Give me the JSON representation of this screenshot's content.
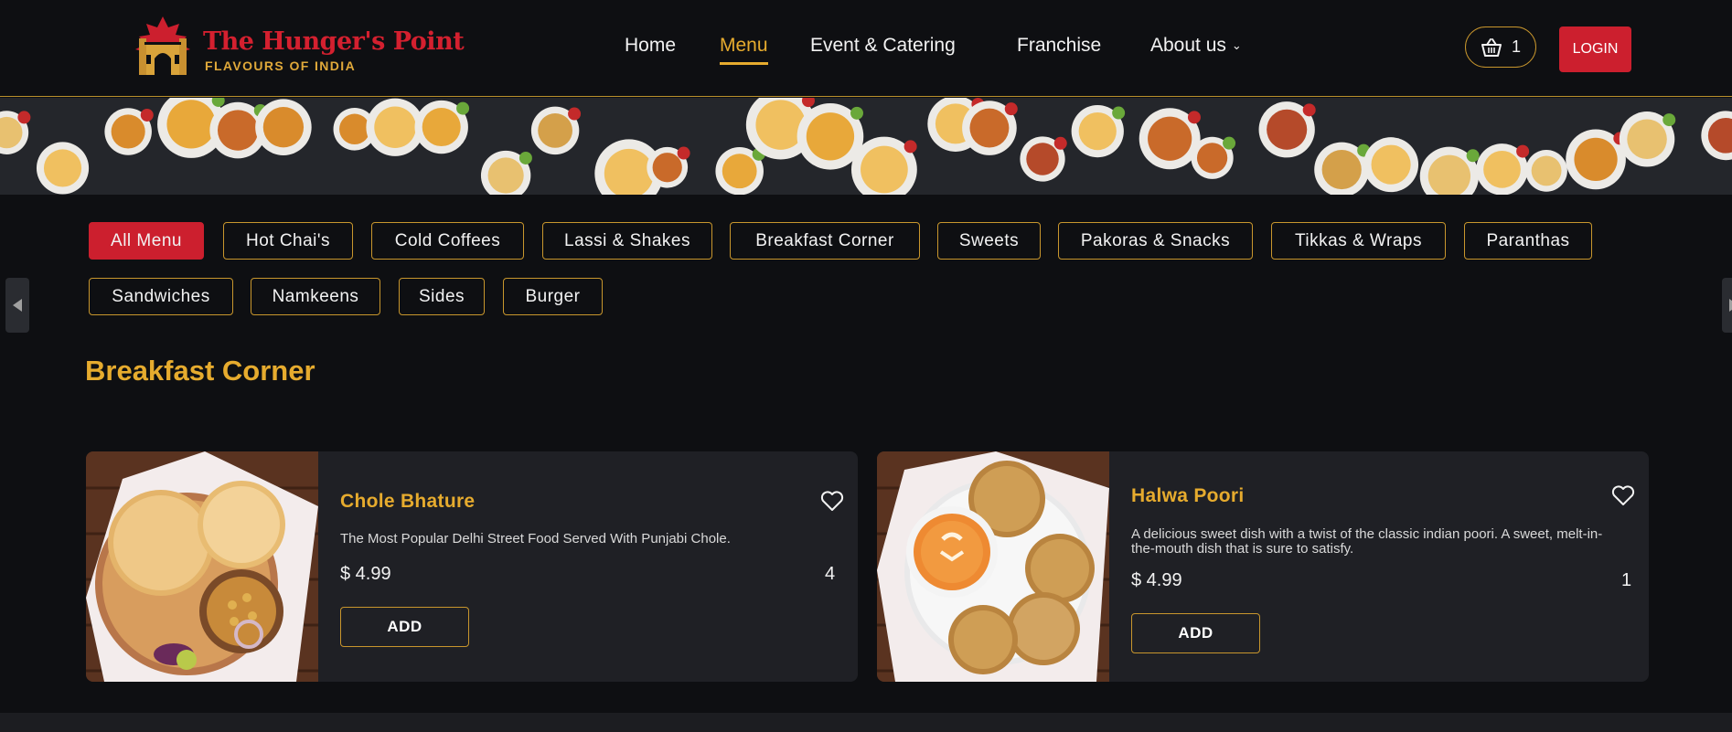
{
  "brand": {
    "name": "The Hunger's Point",
    "tagline": "FLAVOURS OF INDIA",
    "logo_icon": "gate-maple-leaf-icon"
  },
  "nav": {
    "items": [
      {
        "label": "Home",
        "active": false
      },
      {
        "label": "Menu",
        "active": true
      },
      {
        "label": "Event & Catering",
        "active": false
      },
      {
        "label": "Franchise",
        "active": false
      },
      {
        "label": "About us",
        "active": false,
        "has_dropdown": true
      }
    ],
    "cart_count": "1",
    "cart_icon": "basket-icon",
    "login_label": "LOGIN"
  },
  "categories": [
    {
      "label": "All Menu",
      "active": true
    },
    {
      "label": "Hot Chai's"
    },
    {
      "label": "Cold Coffees"
    },
    {
      "label": "Lassi & Shakes"
    },
    {
      "label": "Breakfast Corner"
    },
    {
      "label": "Sweets"
    },
    {
      "label": "Pakoras & Snacks"
    },
    {
      "label": "Tikkas & Wraps"
    },
    {
      "label": "Paranthas"
    },
    {
      "label": "Sandwiches"
    },
    {
      "label": "Namkeens"
    },
    {
      "label": "Sides"
    },
    {
      "label": "Burger"
    }
  ],
  "section": {
    "title": "Breakfast Corner"
  },
  "items": [
    {
      "name": "Chole Bhature",
      "description": "The Most Popular Delhi Street Food Served With Punjabi Chole.",
      "price": "$ 4.99",
      "quantity": "4",
      "add_label": "ADD"
    },
    {
      "name": "Halwa Poori",
      "description": "A delicious sweet dish with a twist of the classic indian poori. A sweet, melt-in-the-mouth dish that is sure to satisfy.",
      "price": "$ 4.99",
      "quantity": "1",
      "add_label": "ADD"
    }
  ],
  "colors": {
    "accent_gold": "#e6ab2e",
    "brand_red": "#cc1f2e",
    "background": "#0e0f12",
    "card_bg": "#1f2025"
  }
}
